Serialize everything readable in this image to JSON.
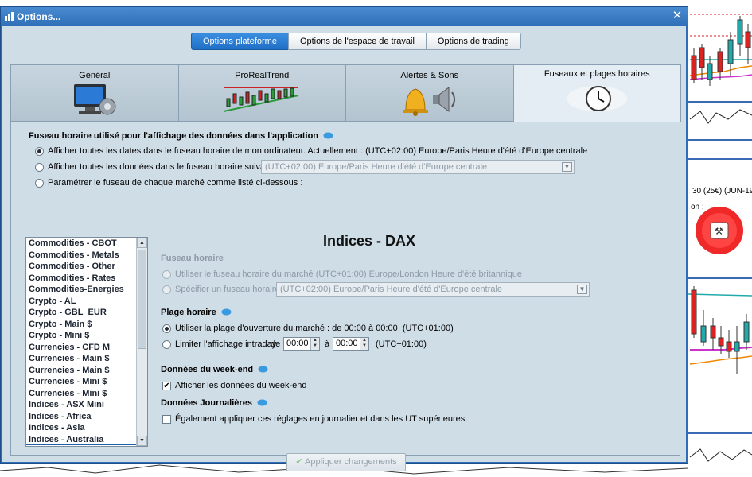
{
  "window": {
    "title": "Options..."
  },
  "top_tabs": [
    {
      "label": "Options plateforme",
      "active": true
    },
    {
      "label": "Options de l'espace de travail",
      "active": false
    },
    {
      "label": "Options de trading",
      "active": false
    }
  ],
  "category_tabs": [
    {
      "label": "Général",
      "icon": "computer-gear-icon"
    },
    {
      "label": "ProRealTrend",
      "icon": "trend-chart-icon"
    },
    {
      "label": "Alertes & Sons",
      "icon": "bell-speaker-icon"
    },
    {
      "label": "Fuseaux et plages horaires",
      "icon": "world-clock-icon",
      "active": true
    }
  ],
  "timezone": {
    "heading": "Fuseau horaire utilisé pour l'affichage des données dans l'application",
    "option1": "Afficher toutes les dates dans le fuseau horaire de mon ordinateur. Actuellement : (UTC+02:00) Europe/Paris Heure d'été d'Europe centrale",
    "option2": "Afficher toutes les données dans le fuseau horaire suivant :",
    "option2_value": "(UTC+02:00) Europe/Paris Heure d'été d'Europe centrale",
    "option3": "Paramétrer le fuseau de chaque marché comme listé ci-dessous :"
  },
  "markets": [
    "Commodities - CBOT",
    "Commodities - Metals",
    "Commodities - Other",
    "Commodities - Rates",
    "Commodities-Energies",
    "Crypto - AL",
    "Crypto - GBL_EUR",
    "Crypto - Main $",
    "Crypto - Mini $",
    "Currencies - CFD M",
    "Currencies - Main $",
    "Currencies - Main $",
    "Currencies - Mini $",
    "Currencies - Mini $",
    "Indices - ASX Mini",
    "Indices - Africa",
    "Indices - Asia",
    "Indices - Australia"
  ],
  "market_settings": {
    "title": "Indices - DAX",
    "tz_heading": "Fuseau horaire",
    "tz_opt1": "Utiliser le fuseau horaire du marché (UTC+01:00) Europe/London Heure d'été britannique",
    "tz_opt2": "Spécifier un fuseau horaire :",
    "tz_opt2_value": "(UTC+02:00) Europe/Paris Heure d'été d'Europe centrale",
    "hours_heading": "Plage horaire",
    "hours_opt1": "Utiliser la plage d'ouverture du marché : de 00:00 à 00:00",
    "hours_opt1_tz": "(UTC+01:00)",
    "hours_opt2": "Limiter l'affichage intraday",
    "hours_de": "de",
    "hours_from": "00:00",
    "hours_a": "à",
    "hours_to": "00:00",
    "hours_opt2_tz": "(UTC+01:00)",
    "weekend_heading": "Données du week-end",
    "weekend_check": "Afficher les données du week-end",
    "daily_heading": "Données Journalières",
    "daily_check": "Également appliquer ces réglages en journalier et dans les UT supérieures."
  },
  "apply_label": "Appliquer changements",
  "colors": {
    "accent": "#1f6fc6",
    "frame": "#2f6fb7",
    "panel": "#cfdde7"
  }
}
